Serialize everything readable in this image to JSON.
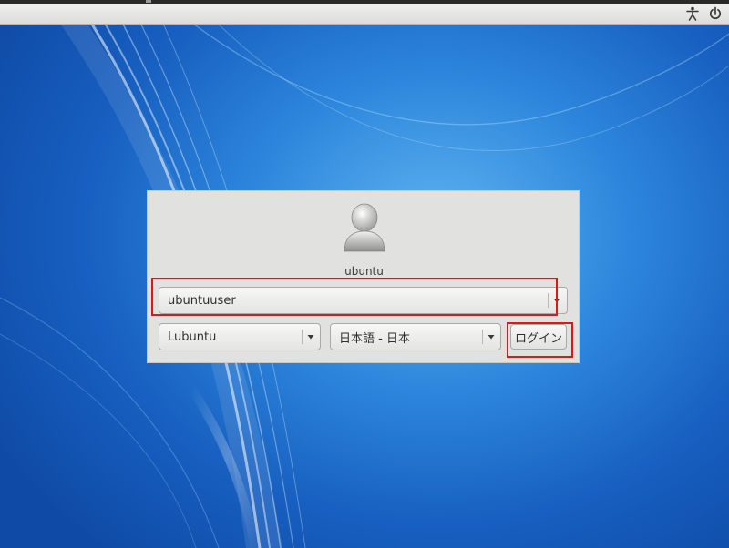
{
  "panel": {
    "icons": {
      "accessibility": "accessibility-icon",
      "power": "power-icon"
    }
  },
  "greeter": {
    "avatar_icon": "user-avatar-icon",
    "user_label": "ubuntu",
    "username_value": "ubuntuuser",
    "session_value": "Lubuntu",
    "language_value": "日本語 - 日本",
    "login_label": "ログイン"
  },
  "annotations": {
    "highlight_color": "#e31515"
  },
  "colors": {
    "wallpaper_blue": "#1e6fc9",
    "panel_gray": "#e6e6e4",
    "greeter_bg": "#e1e1e0"
  }
}
